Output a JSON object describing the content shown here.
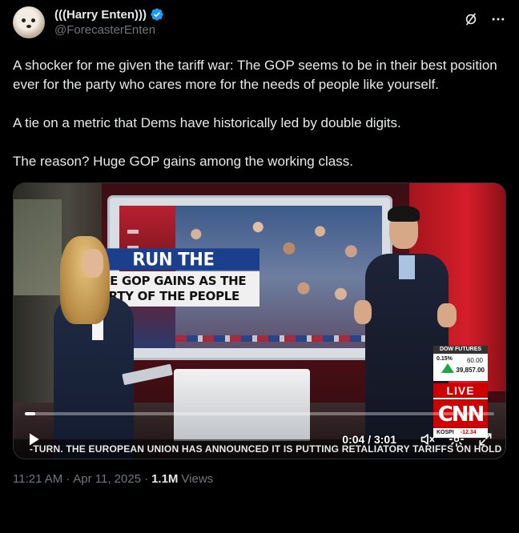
{
  "author": {
    "display_name": "(((Harry Enten)))",
    "handle": "@ForecasterEnten",
    "verified_color": "#1d9bf0"
  },
  "header_icons": [
    "grok-icon",
    "more-icon"
  ],
  "tweet": {
    "paragraphs": [
      "A shocker for me given the tariff war: The GOP seems to be in their best position ever for the party who cares more for the needs of people like yourself.",
      "A tie on a metric that Dems have historically led by double digits.",
      "The reason? Huge GOP gains among the working class."
    ]
  },
  "video": {
    "screen_title": "RUN THE NUMBERS",
    "screen_subtitle": "THE GOP GAINS AS THE PARTY OF THE PEOPLE",
    "dow": {
      "title": "DOW FUTURES",
      "pct": "0.15%",
      "change": "60.00",
      "value": "39,857.00"
    },
    "live_label": "LIVE",
    "network": "CNN",
    "kospi": {
      "label": "KOSPI",
      "value": "-12.34"
    },
    "ticker": "-TURN. THE EUROPEAN UNION HAS ANNOUNCED IT IS PUTTING RETALIATORY TARIFFS ON HOLD IN RESPONSE TO TRUMP'S PAUSE",
    "time": "0:04 / 3:01",
    "progress": 0.022
  },
  "meta": {
    "time": "11:21 AM",
    "sep1": "·",
    "date": "Apr 11, 2025",
    "sep2": "·",
    "views_count": "1.1M",
    "views_label": "Views"
  }
}
